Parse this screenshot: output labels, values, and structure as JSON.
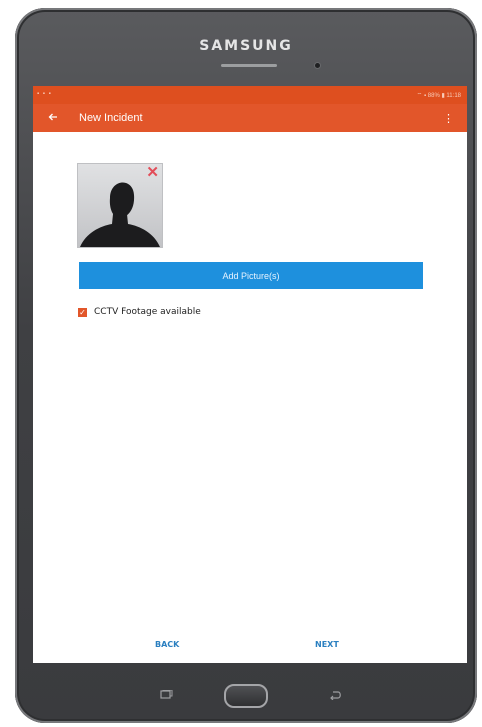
{
  "device": {
    "brand": "SAMSUNG"
  },
  "status_bar": {
    "left_icons": "▪ ▪ ▪",
    "right_text": "⌔ ▪ 88% ▮ 11:18"
  },
  "app_bar": {
    "back_icon": "arrow-back-icon",
    "title": "New Incident",
    "overflow": "⋮"
  },
  "photo": {
    "icon": "person-silhouette-icon",
    "remove_symbol": "✕"
  },
  "add_button": {
    "label": "Add Picture(s)"
  },
  "cctv": {
    "checked": true,
    "check_symbol": "✓",
    "label": "CCTV Footage available"
  },
  "nav": {
    "back": "BACK",
    "next": "NEXT"
  },
  "colors": {
    "accent": "#E2562A",
    "button": "#1E90DD",
    "link": "#2A7FC0",
    "remove": "#E24D59"
  }
}
